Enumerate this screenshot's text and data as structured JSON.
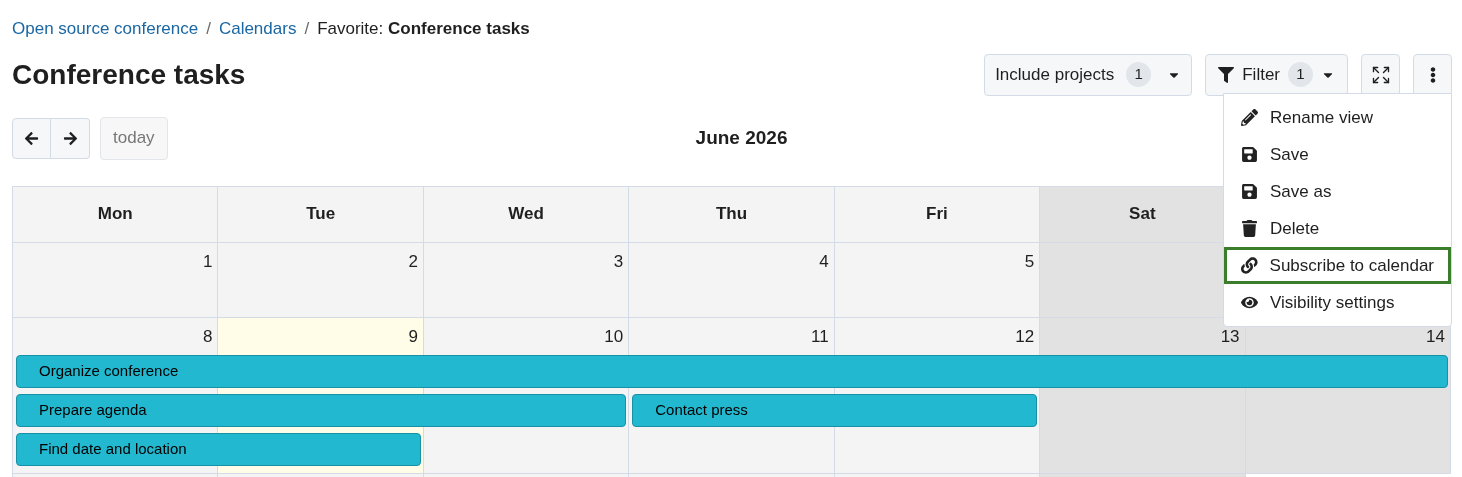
{
  "breadcrumb": {
    "links": [
      "Open source conference",
      "Calendars"
    ],
    "separators": [
      "/",
      "/"
    ],
    "current_prefix": "Favorite:",
    "current": "Conference tasks"
  },
  "title": "Conference tasks",
  "toolbar": {
    "include_projects": {
      "label": "Include projects",
      "count": "1"
    },
    "filter": {
      "label": "Filter",
      "count": "1"
    }
  },
  "menu": [
    {
      "label": "Rename view",
      "selected": false
    },
    {
      "label": "Save",
      "selected": false
    },
    {
      "label": "Save as",
      "selected": false
    },
    {
      "label": "Delete",
      "selected": false
    },
    {
      "label": "Subscribe to calendar",
      "selected": true
    },
    {
      "label": "Visibility settings",
      "selected": false
    }
  ],
  "calendar": {
    "nav": {
      "today": "today"
    },
    "month": "June 2026",
    "headers": [
      {
        "label": "Mon",
        "weekend": false
      },
      {
        "label": "Tue",
        "weekend": false
      },
      {
        "label": "Wed",
        "weekend": false
      },
      {
        "label": "Thu",
        "weekend": false
      },
      {
        "label": "Fri",
        "weekend": false
      },
      {
        "label": "Sat",
        "weekend": true
      }
    ],
    "weeks": [
      {
        "cells": [
          {
            "day": "1",
            "today": false,
            "weekend": false
          },
          {
            "day": "2",
            "today": false,
            "weekend": false
          },
          {
            "day": "3",
            "today": false,
            "weekend": false
          },
          {
            "day": "4",
            "today": false,
            "weekend": false
          },
          {
            "day": "5",
            "today": false,
            "weekend": false
          },
          {
            "today": false,
            "weekend": true
          }
        ]
      },
      {
        "cells": [
          {
            "day": "8",
            "today": false,
            "weekend": false
          },
          {
            "day": "9",
            "today": true,
            "weekend": false
          },
          {
            "day": "10",
            "today": false,
            "weekend": false
          },
          {
            "day": "11",
            "today": false,
            "weekend": false
          },
          {
            "day": "12",
            "today": false,
            "weekend": false
          },
          {
            "day": "13",
            "today": false,
            "weekend": true
          },
          {
            "day": "14",
            "today": false,
            "weekend": true
          }
        ],
        "lanes": [
          [
            {
              "kind": "event",
              "title": "Organize conference"
            },
            {
              "kind": "continue"
            },
            {
              "kind": "continue"
            },
            {
              "kind": "continue"
            },
            {
              "kind": "continue"
            },
            {
              "kind": "continue"
            },
            {
              "kind": "continue"
            }
          ],
          [
            {
              "kind": "event",
              "title": "Prepare agenda"
            },
            {
              "kind": "continue"
            },
            {
              "kind": "continue"
            },
            {
              "kind": "event",
              "title": "Contact press"
            },
            {
              "kind": "continue"
            },
            {
              "kind": "empty"
            },
            {
              "kind": "empty"
            }
          ],
          [
            {
              "kind": "event",
              "title": "Find date and location"
            },
            {
              "kind": "continue"
            },
            {
              "kind": "empty"
            },
            {
              "kind": "empty"
            },
            {
              "kind": "empty"
            },
            {
              "kind": "empty"
            },
            {
              "kind": "empty"
            }
          ]
        ]
      }
    ]
  }
}
